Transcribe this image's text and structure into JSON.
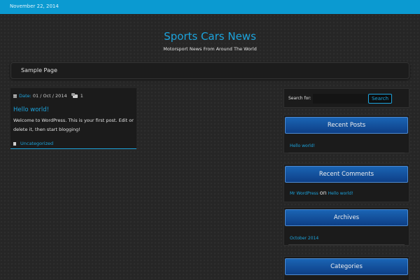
{
  "topbar": {
    "date": "November 22, 2014"
  },
  "header": {
    "site_title": "Sports Cars News",
    "tagline": "Motorsport News From Around The World"
  },
  "nav": {
    "items": [
      {
        "label": "Sample Page"
      }
    ]
  },
  "post": {
    "date_label": "Date:",
    "date_value": "01 / Oct / 2014",
    "comment_count": "1",
    "title": "Hello world!",
    "excerpt": "Welcome to WordPress. This is your first post. Edit or delete it, then start blogging!",
    "category": "Uncategorized"
  },
  "search": {
    "label": "Search for:",
    "value": "",
    "button": "Search"
  },
  "widgets": {
    "recent_posts": {
      "title": "Recent Posts",
      "items": [
        "Hello world!"
      ]
    },
    "recent_comments": {
      "title": "Recent Comments",
      "items": [
        {
          "author": "Mr WordPress",
          "connector": "on",
          "post": "Hello world!"
        }
      ]
    },
    "archives": {
      "title": "Archives",
      "items": [
        "October 2014"
      ]
    },
    "categories": {
      "title": "Categories"
    }
  },
  "colors": {
    "accent": "#1ca3dc",
    "topbar": "#0b9ad1",
    "widget_header": "#1a64b4",
    "background": "#262626"
  }
}
